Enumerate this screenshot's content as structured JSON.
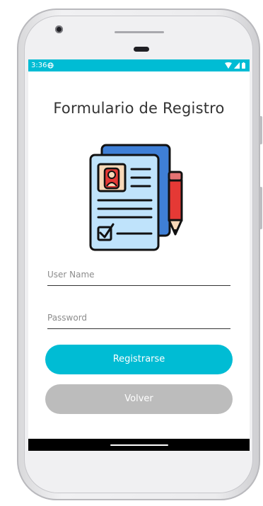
{
  "status_bar": {
    "time": "3:36"
  },
  "form": {
    "title": "Formulario de Registro",
    "username_placeholder": "User Name",
    "password_placeholder": "Password",
    "register_label": "Registrarse",
    "back_label": "Volver"
  },
  "colors": {
    "accent": "#00bcd4",
    "secondary_button": "#bcbcbc"
  },
  "icons": {
    "status": [
      "globe-icon",
      "wifi-icon",
      "signal-icon",
      "battery-icon"
    ],
    "illustration": "registration-form-illustration"
  }
}
